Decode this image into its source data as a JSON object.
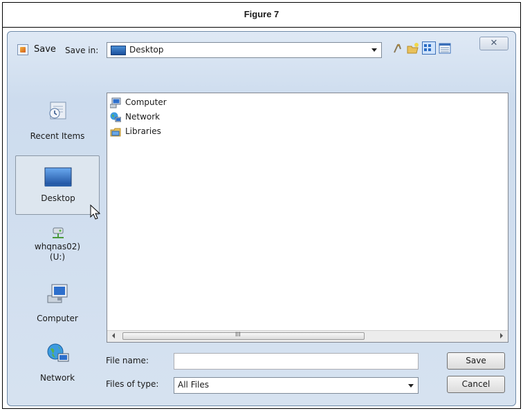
{
  "figure": {
    "title": "Figure 7"
  },
  "window": {
    "title": "Save",
    "close_glyph": "✕"
  },
  "toolbar": {
    "save_in_label": "Save in:",
    "save_in_value": "Desktop",
    "icons": [
      "up-folder-icon",
      "new-folder-icon",
      "list-view-icon",
      "details-view-icon"
    ]
  },
  "places": [
    {
      "label": "Recent Items",
      "icon": "recent-items-icon"
    },
    {
      "label": "Desktop",
      "icon": "desktop-icon",
      "selected": true
    },
    {
      "label_line1": "whqnas02)",
      "label_line2": "(U:)",
      "icon": "network-drive-icon"
    },
    {
      "label": "Computer",
      "icon": "computer-icon"
    },
    {
      "label": "Network",
      "icon": "network-icon"
    }
  ],
  "files": [
    {
      "name": "Computer",
      "icon": "computer-icon"
    },
    {
      "name": "Network",
      "icon": "network-icon"
    },
    {
      "name": "Libraries",
      "icon": "libraries-icon"
    }
  ],
  "scrollbar": {
    "grip": "III"
  },
  "form": {
    "file_name_label": "File name:",
    "file_name_value": "",
    "file_type_label": "Files of type:",
    "file_type_value": "All Files"
  },
  "buttons": {
    "save": "Save",
    "cancel": "Cancel"
  },
  "colors": {
    "window_frame": "#cddcee",
    "accent": "#1b4f9c"
  }
}
